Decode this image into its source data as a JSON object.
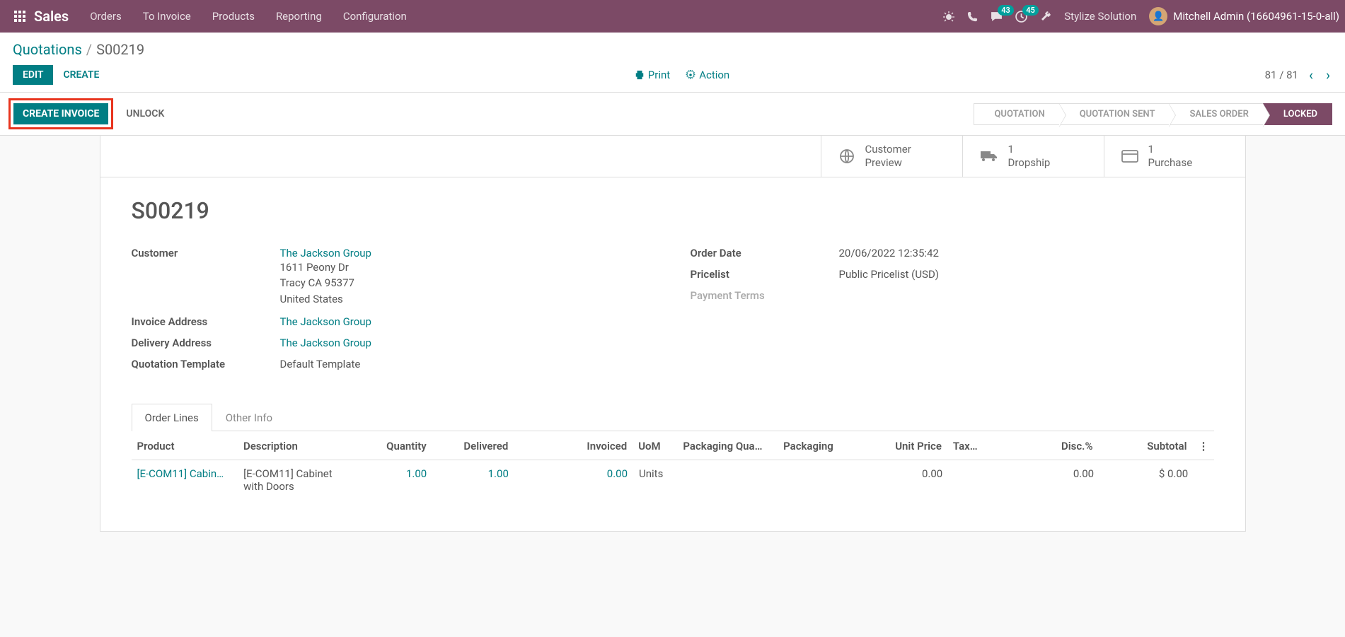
{
  "nav": {
    "brand": "Sales",
    "menu": [
      "Orders",
      "To Invoice",
      "Products",
      "Reporting",
      "Configuration"
    ],
    "messages_badge": "43",
    "activities_badge": "45",
    "stylize": "Stylize Solution",
    "user": "Mitchell Admin (16604961-15-0-all)"
  },
  "breadcrumb": {
    "parent": "Quotations",
    "current": "S00219"
  },
  "actions": {
    "edit": "EDIT",
    "create": "CREATE",
    "print": "Print",
    "action": "Action"
  },
  "pager": {
    "text": "81 / 81"
  },
  "statusbar": {
    "create_invoice": "CREATE INVOICE",
    "unlock": "UNLOCK",
    "steps": [
      "QUOTATION",
      "QUOTATION SENT",
      "SALES ORDER",
      "LOCKED"
    ]
  },
  "stats": {
    "preview": {
      "line1": "Customer",
      "line2": "Preview"
    },
    "dropship": {
      "count": "1",
      "label": "Dropship"
    },
    "purchase": {
      "count": "1",
      "label": "Purchase"
    }
  },
  "order": {
    "name": "S00219",
    "labels": {
      "customer": "Customer",
      "invoice_addr": "Invoice Address",
      "delivery_addr": "Delivery Address",
      "quote_tmpl": "Quotation Template",
      "order_date": "Order Date",
      "pricelist": "Pricelist",
      "payment_terms": "Payment Terms"
    },
    "customer_name": "The Jackson Group",
    "customer_addr1": "1611 Peony Dr",
    "customer_addr2": "Tracy CA 95377",
    "customer_addr3": "United States",
    "invoice_address": "The Jackson Group",
    "delivery_address": "The Jackson Group",
    "quotation_template": "Default Template",
    "order_date": "20/06/2022 12:35:42",
    "pricelist": "Public Pricelist (USD)"
  },
  "tabs": {
    "order_lines": "Order Lines",
    "other_info": "Other Info"
  },
  "table": {
    "headers": {
      "product": "Product",
      "description": "Description",
      "quantity": "Quantity",
      "delivered": "Delivered",
      "invoiced": "Invoiced",
      "uom": "UoM",
      "pkg_qty": "Packaging Qua…",
      "packaging": "Packaging",
      "unit_price": "Unit Price",
      "taxes": "Tax…",
      "disc": "Disc.%",
      "subtotal": "Subtotal"
    },
    "row": {
      "product": "[E-COM11] Cabin…",
      "description": "[E-COM11] Cabinet with Doors",
      "quantity": "1.00",
      "delivered": "1.00",
      "invoiced": "0.00",
      "uom": "Units",
      "unit_price": "0.00",
      "disc": "0.00",
      "subtotal": "$ 0.00"
    }
  }
}
